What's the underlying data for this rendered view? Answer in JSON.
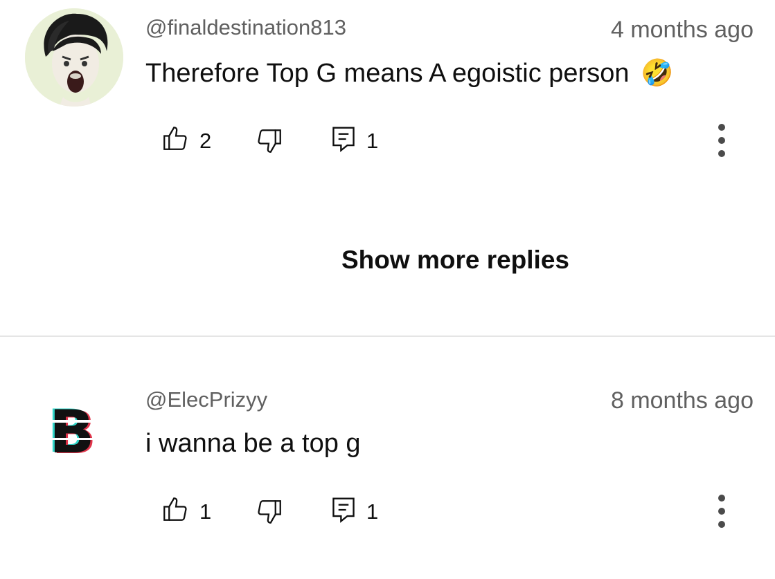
{
  "comments": [
    {
      "handle": "@finaldestination813",
      "time": "4 months ago",
      "text": "Therefore Top G means A egoistic person",
      "emoji": "🤣",
      "likes": "2",
      "replies": "1",
      "avatar_icon": "screaming-face-avatar"
    },
    {
      "handle": "@ElecPrizyy",
      "time": "8 months ago",
      "text": "i wanna be a top g",
      "likes": "1",
      "replies": "1",
      "avatar_icon": "glitch-letter-avatar",
      "avatar_letter": "B"
    }
  ],
  "show_more_label": "Show more replies",
  "colors": {
    "primary_text": "#0f0f0f",
    "secondary_text": "#606060",
    "divider": "#e5e5e5",
    "avatar_bg": "#eaf0d8"
  }
}
